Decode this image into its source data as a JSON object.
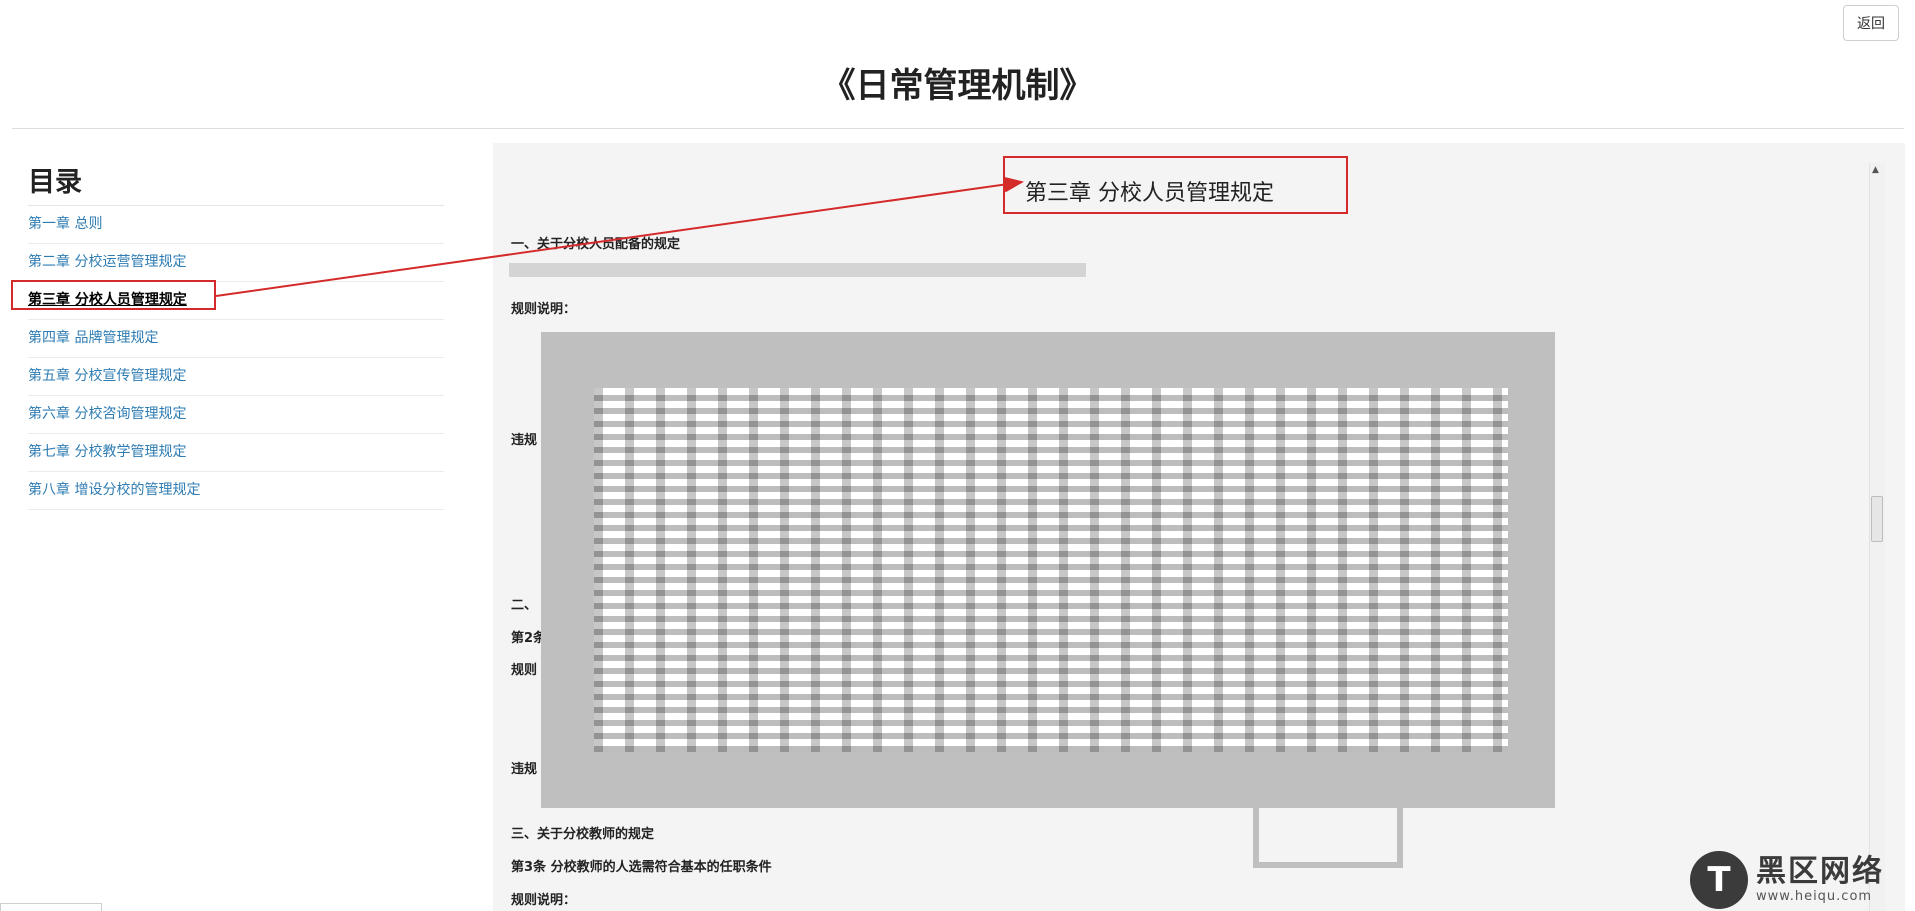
{
  "header": {
    "back_label": "返回",
    "title": "《日常管理机制》"
  },
  "toc": {
    "heading": "目录",
    "items": [
      {
        "label": "第一章 总则"
      },
      {
        "label": "第二章 分校运营管理规定"
      },
      {
        "label": "第三章 分校人员管理规定"
      },
      {
        "label": "第四章 品牌管理规定"
      },
      {
        "label": "第五章 分校宣传管理规定"
      },
      {
        "label": "第六章 分校咨询管理规定"
      },
      {
        "label": "第七章 分校教学管理规定"
      },
      {
        "label": "第八章 增设分校的管理规定"
      }
    ],
    "active_index": 2
  },
  "content": {
    "chapter_title": "第三章 分校人员管理规定",
    "lines": {
      "section1": "一、关于分校人员配备的规定",
      "rule_desc_1": "规则说明：",
      "violation_1": "违规",
      "section2": "二、",
      "article2": "第2条",
      "rule_desc_2": "规则",
      "violation_2": "违规",
      "section3": "三、关于分校教师的规定",
      "article3": "第3条 分校教师的人选需符合基本的任职条件",
      "rule_desc_3": "规则说明："
    }
  },
  "watermark": {
    "logo_glyph": "T",
    "name": "黑区网络",
    "url": "www.heiqu.com"
  },
  "colors": {
    "link": "#2e7cb3",
    "highlight": "#d42a2a",
    "content_bg": "#f4f4f4",
    "redaction": "#bfbfbf"
  }
}
